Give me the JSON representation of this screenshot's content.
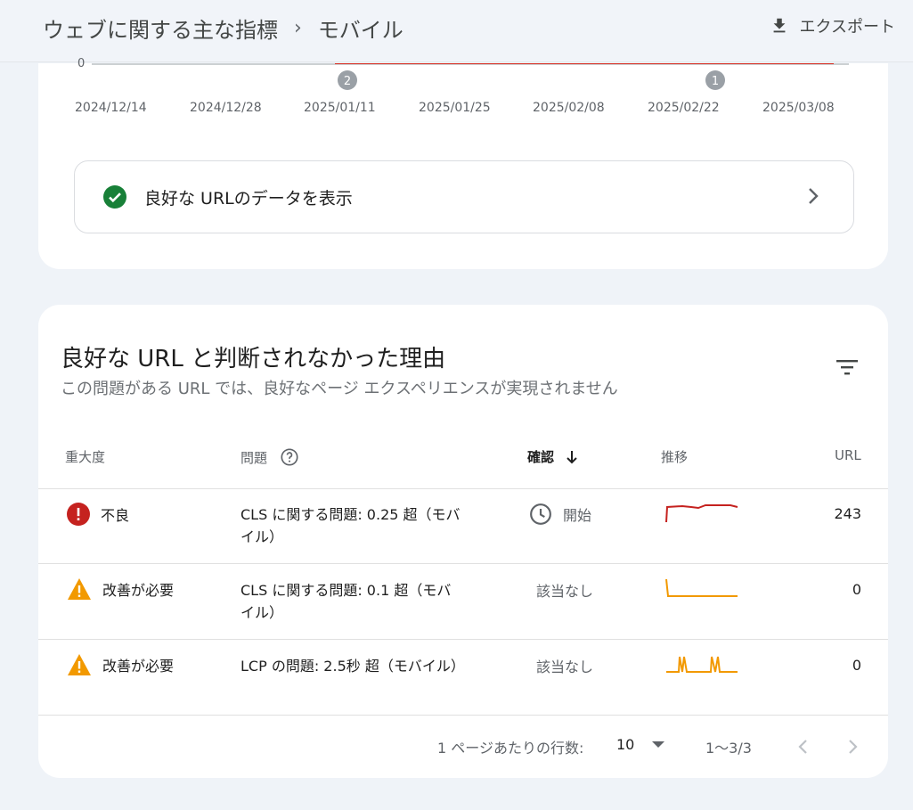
{
  "header": {
    "breadcrumb_root": "ウェブに関する主な指標",
    "breadcrumb_current": "モバイル",
    "export_label": "エクスポート"
  },
  "chart": {
    "zero_label": "0",
    "dates": [
      "2024/12/14",
      "2024/12/28",
      "2025/01/11",
      "2025/01/25",
      "2025/02/08",
      "2025/02/22",
      "2025/03/08"
    ],
    "markers": [
      {
        "label": "2",
        "date": "2025/01/11"
      },
      {
        "label": "1",
        "date": "2025/02/22"
      }
    ]
  },
  "good_urls": {
    "label": "良好な URLのデータを表示"
  },
  "issues_card": {
    "title": "良好な URL と判断されなかった理由",
    "subtitle": "この問題がある URL では、良好なページ エクスペリエンスが実現されません",
    "columns": {
      "severity": "重大度",
      "issue": "問題",
      "validation": "確認",
      "trend": "推移",
      "urls": "URL"
    },
    "rows": [
      {
        "severity": "不良",
        "severity_color": "#c5221f",
        "issue": "CLS に関する問題: 0.25 超（モバイル）",
        "validation": "開始",
        "trend_color": "#c5221f",
        "urls": "243"
      },
      {
        "severity": "改善が必要",
        "severity_color": "#f29900",
        "issue": "CLS に関する問題: 0.1 超（モバイル）",
        "validation": "該当なし",
        "trend_color": "#f29900",
        "urls": "0"
      },
      {
        "severity": "改善が必要",
        "severity_color": "#f29900",
        "issue": "LCP の問題: 2.5秒 超（モバイル）",
        "validation": "該当なし",
        "trend_color": "#f29900",
        "urls": "0"
      }
    ],
    "pagination": {
      "rows_per_page_label": "1 ページあたりの行数:",
      "rows_per_page_value": "10",
      "range": "1〜3/3"
    }
  }
}
